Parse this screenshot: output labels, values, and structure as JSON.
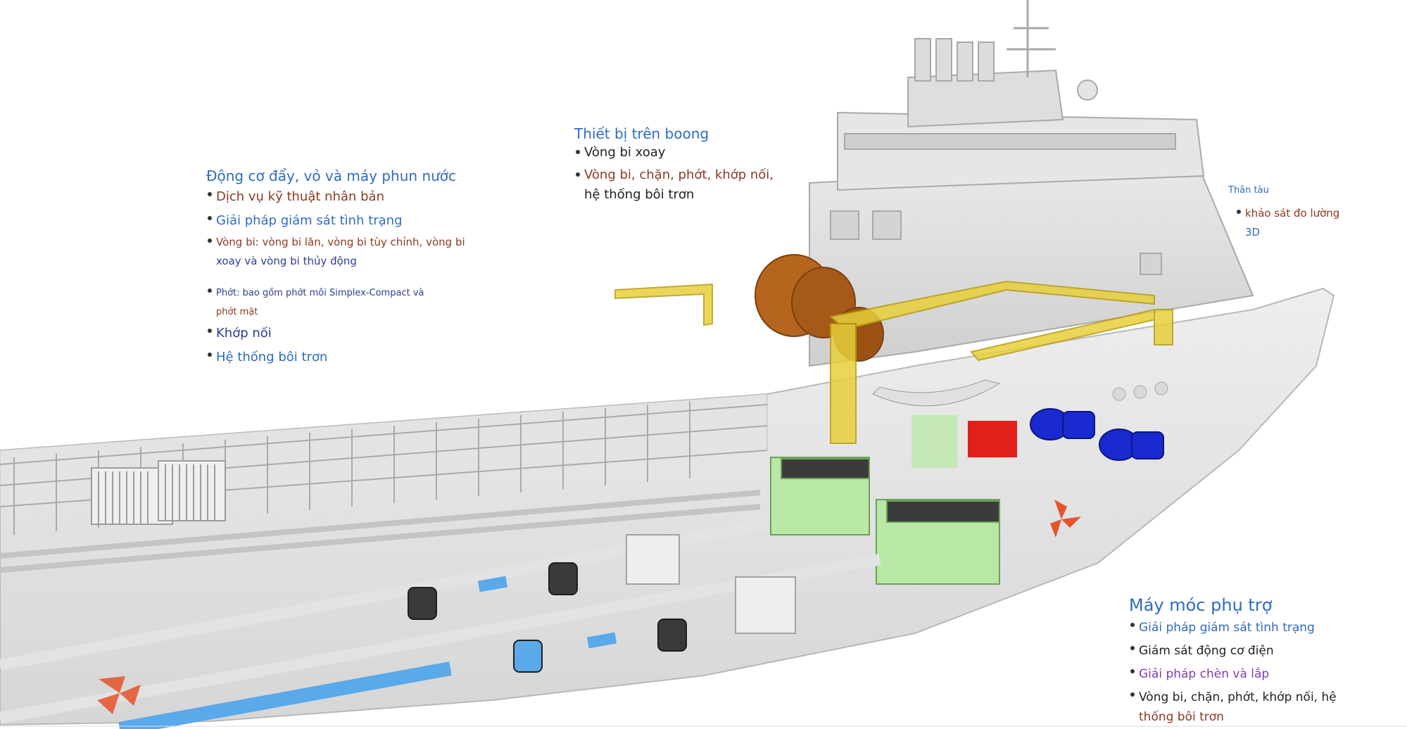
{
  "propulsion": {
    "title": "Động cơ đẩy, vỏ và máy phun nước",
    "items": [
      "Dịch vụ kỹ thuật nhân bản",
      "Giải pháp giám sát tình trạng",
      "Vòng bi: vòng bi lăn, vòng bi tùy chỉnh, vòng bi",
      "xoay và vòng bi thủy động",
      "Phớt: bao gồm phớt môi Simplex-Compact và",
      "phớt mặt",
      "Khớp nối",
      "Hệ thống bôi trơn"
    ]
  },
  "deck": {
    "title": "Thiết bị trên boong",
    "items": [
      "Vòng bi xoay",
      "Vòng bi, chặn, phớt, khớp nối,",
      "hệ thống bôi trơn"
    ]
  },
  "hull": {
    "title": "Thân tàu",
    "items": [
      "khảo sát đo lường",
      "3D"
    ]
  },
  "aux": {
    "title": "Máy móc phụ trợ",
    "items": [
      "Giải pháp giám sát tình trạng",
      "Giám sát động cơ điện",
      "Giải pháp chèn và lắp",
      "Vòng bi, chặn, phớt, khớp nối, hệ",
      "thống bôi trơn"
    ]
  },
  "colors": {
    "title_blue": "#2f6bc4",
    "engine_green": "#b9e8a6",
    "shaft_blue": "#5aa9ea",
    "crane_yellow": "#e8cf3a",
    "winch_brown": "#b5651d",
    "pump_blue": "#1a2ad1",
    "box_red": "#e0201a",
    "propeller_orange": "#e5532b"
  }
}
